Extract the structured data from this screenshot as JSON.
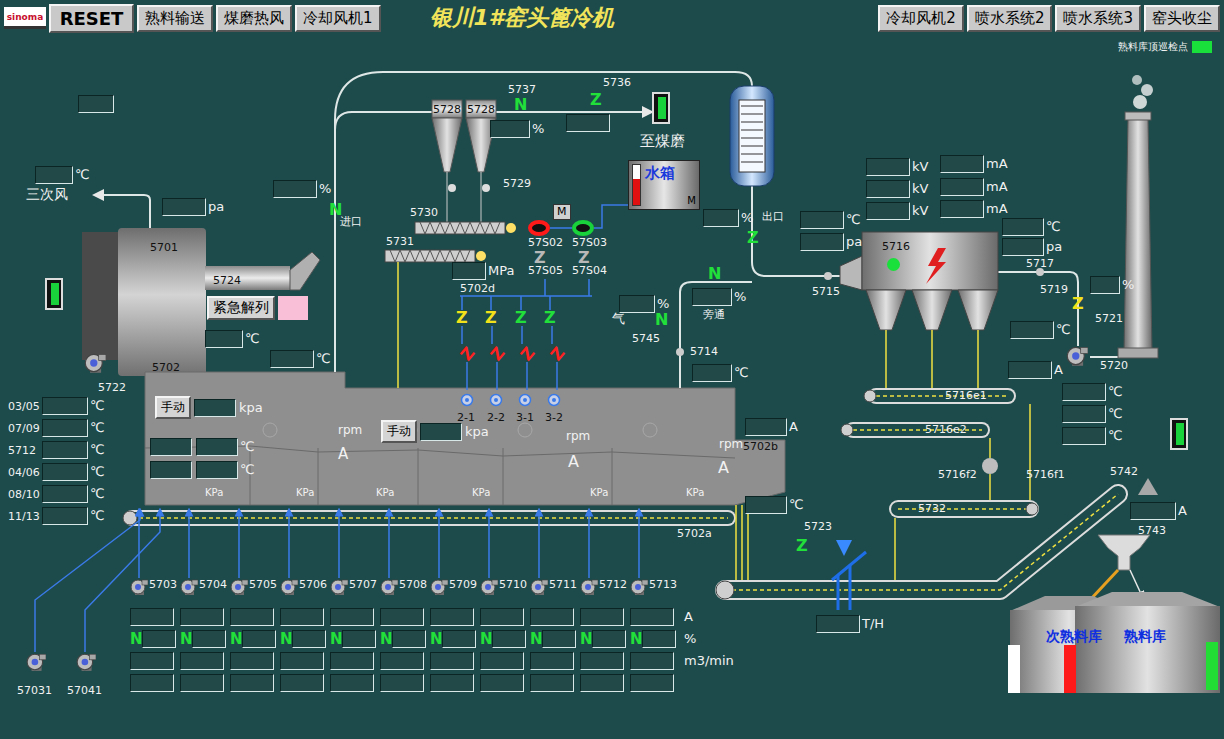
{
  "header": {
    "logo": "sinoma",
    "reset": "RESET",
    "left_buttons": [
      "熟料输送",
      "煤磨热风",
      "冷却风机1"
    ],
    "title": "银川1#窑头篦冷机",
    "right_buttons": [
      "冷却风机2",
      "喷水系统2",
      "喷水系统3",
      "窑头收尘"
    ]
  },
  "inspection": {
    "label": "熟料库顶巡检点",
    "on": true
  },
  "labels": [
    "5701",
    "5724",
    "5702",
    "5722",
    "三次风",
    "5737",
    "5736",
    "至煤磨",
    "5728",
    "5728",
    "5729",
    "5730",
    "5731",
    "进口",
    "出口",
    "57S02",
    "57S03",
    "57S05",
    "57S04",
    "5702d",
    "气",
    "5745",
    "旁通",
    "5714",
    "5715",
    "5716",
    "5717",
    "5719",
    "5721",
    "5720",
    "5716e1",
    "5716e2",
    "5716f2",
    "5716f1",
    "5732",
    "5742",
    "5743",
    "5723",
    "5702a",
    "5702b",
    "2-1",
    "2-2",
    "3-1",
    "3-2",
    "rpm",
    "A",
    "rpm",
    "A",
    "rpm",
    "A",
    "KPa",
    "KPa",
    "KPa",
    "KPa",
    "KPa",
    "KPa",
    "57031",
    "57041"
  ],
  "readouts": [
    {
      "unit": ""
    },
    {
      "unit": "℃"
    },
    {
      "unit": "pa"
    },
    {
      "unit": "%"
    },
    {
      "unit": "℃"
    },
    {
      "unit": "℃"
    },
    {
      "unit": "%"
    },
    {
      "unit": ""
    },
    {
      "unit": "%"
    },
    {
      "unit": "MPa"
    },
    {
      "unit": "%"
    },
    {
      "unit": "%"
    },
    {
      "unit": "℃"
    },
    {
      "unit": "℃"
    },
    {
      "unit": "pa"
    },
    {
      "unit": "kV"
    },
    {
      "unit": "kV"
    },
    {
      "unit": "kV"
    },
    {
      "unit": "mA"
    },
    {
      "unit": "mA"
    },
    {
      "unit": "mA"
    },
    {
      "unit": "℃"
    },
    {
      "unit": "pa"
    },
    {
      "unit": "%"
    },
    {
      "unit": "℃"
    },
    {
      "unit": "A"
    },
    {
      "unit": "℃"
    },
    {
      "unit": "℃"
    },
    {
      "unit": "℃"
    },
    {
      "unit": "A"
    },
    {
      "unit": "℃"
    },
    {
      "unit": "A"
    },
    {
      "unit": "T/H"
    },
    {
      "unit": ""
    },
    {
      "unit": "℃"
    },
    {
      "unit": ""
    },
    {
      "unit": "℃"
    }
  ],
  "left_temps": [
    {
      "label": "03/05",
      "unit": "℃"
    },
    {
      "label": "07/09",
      "unit": "℃"
    },
    {
      "label": "5712",
      "unit": "℃"
    },
    {
      "label": "04/06",
      "unit": "℃"
    },
    {
      "label": "08/10",
      "unit": "℃"
    },
    {
      "label": "11/13",
      "unit": "℃"
    }
  ],
  "manual": [
    {
      "button": "手动",
      "unit": "kpa"
    },
    {
      "button": "手动",
      "unit": "kpa"
    }
  ],
  "emergency": {
    "label": "紧急解列",
    "on": true
  },
  "water_tank": {
    "label": "水箱",
    "motor": "M",
    "level": 0.65
  },
  "motor_box": "M",
  "pumps": [
    {
      "color": "#ff1a1a"
    },
    {
      "color": "#19d13a"
    }
  ],
  "valves": [
    {
      "letter": "N",
      "color": "#22e03a"
    },
    {
      "letter": "Z",
      "color": "#22e03a"
    },
    {
      "letter": "N",
      "color": "#22e03a"
    },
    {
      "letter": "Z",
      "color": "#22e03a"
    },
    {
      "letter": "N",
      "color": "#22e03a"
    },
    {
      "letter": "N",
      "color": "#22e03a"
    },
    {
      "letter": "Z",
      "color": "#f2e21a"
    },
    {
      "letter": "Z",
      "color": "#f2e21a"
    },
    {
      "letter": "Z",
      "color": "#f2e21a"
    },
    {
      "letter": "Z",
      "color": "#22e03a"
    },
    {
      "letter": "Z",
      "color": "#22e03a"
    },
    {
      "letter": "Z",
      "color": "#b8b8b8"
    },
    {
      "letter": "Z",
      "color": "#b8b8b8"
    },
    {
      "letter": "Z",
      "color": "#22e03a"
    }
  ],
  "spray_valves": [
    {
      "letter": "Z",
      "color": "#ff2020"
    },
    {
      "letter": "Z",
      "color": "#ff2020"
    },
    {
      "letter": "Z",
      "color": "#ff2020"
    },
    {
      "letter": "Z",
      "color": "#ff2020"
    }
  ],
  "esp": {
    "running": true
  },
  "fans": {
    "units": [
      "A",
      "%",
      "m3/min"
    ],
    "items": [
      {
        "label": "5703",
        "valve": "N"
      },
      {
        "label": "5704",
        "valve": "N"
      },
      {
        "label": "5705",
        "valve": "N"
      },
      {
        "label": "5706",
        "valve": "N"
      },
      {
        "label": "5707",
        "valve": "N"
      },
      {
        "label": "5708",
        "valve": "N"
      },
      {
        "label": "5709",
        "valve": "N"
      },
      {
        "label": "5710",
        "valve": "N"
      },
      {
        "label": "5711",
        "valve": "N"
      },
      {
        "label": "5712",
        "valve": "N"
      },
      {
        "label": "5713",
        "valve": "N"
      }
    ]
  },
  "silos": [
    {
      "label": "次熟料库",
      "colors": [
        "#ffffff",
        "#ff1a1a"
      ]
    },
    {
      "label": "熟料库",
      "colors": [
        "#22dd33"
      ]
    }
  ]
}
